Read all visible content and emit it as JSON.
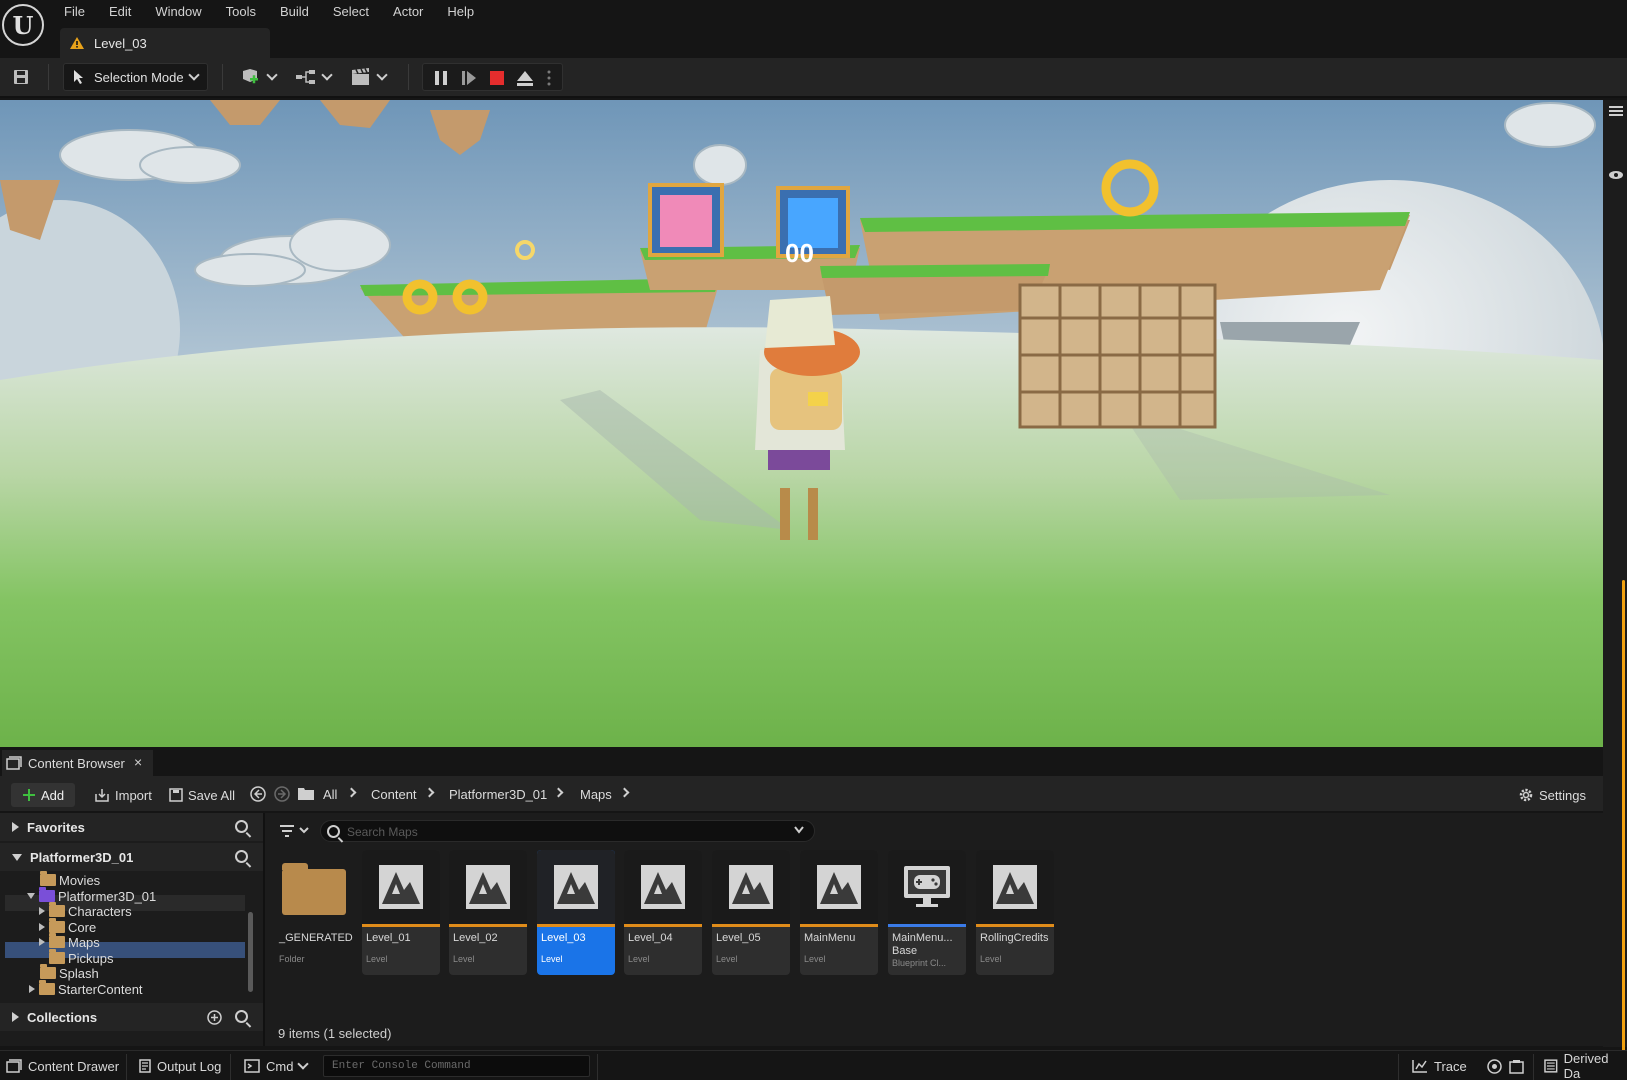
{
  "app": {
    "logo_text": "U",
    "menu": [
      "File",
      "Edit",
      "Window",
      "Tools",
      "Build",
      "Select",
      "Actor",
      "Help"
    ],
    "level_tab": "Level_03"
  },
  "toolbar": {
    "selection_mode": "Selection Mode",
    "icons": [
      "save-icon",
      "add-actor-icon",
      "blueprint-icon",
      "cinematics-icon",
      "pause-icon",
      "step-icon",
      "stop-icon",
      "eject-icon",
      "more-icon"
    ]
  },
  "viewport": {
    "scene": "game-viewport",
    "sky_color": "#8eb3cf",
    "ground_color": "#7cc26a",
    "portal_text": "00"
  },
  "content_browser": {
    "tab_label": "Content Browser",
    "add_label": "Add",
    "import_label": "Import",
    "save_all_label": "Save All",
    "settings_label": "Settings",
    "breadcrumbs": [
      "All",
      "Content",
      "Platformer3D_01",
      "Maps"
    ],
    "search_placeholder": "Search Maps",
    "favorites_label": "Favorites",
    "project_label": "Platformer3D_01",
    "collections_label": "Collections",
    "tree": [
      "Movies",
      "Platformer3D_01",
      "Characters",
      "Core",
      "Maps",
      "Pickups",
      "Splash",
      "StarterContent"
    ],
    "assets": [
      {
        "name": "_GENERATED",
        "type": "Folder"
      },
      {
        "name": "Level_01",
        "type": "Level"
      },
      {
        "name": "Level_02",
        "type": "Level"
      },
      {
        "name": "Level_03",
        "type": "Level"
      },
      {
        "name": "Level_04",
        "type": "Level"
      },
      {
        "name": "Level_05",
        "type": "Level"
      },
      {
        "name": "MainMenu",
        "type": "Level"
      },
      {
        "name": "MainMenu... Base",
        "type": "Blueprint Cl..."
      },
      {
        "name": "RollingCredits",
        "type": "Level"
      }
    ],
    "items_count": "9 items (1 selected)",
    "selected_index": 3,
    "colors": {
      "level_bar": "#e08c1a",
      "blueprint_bar": "#3a7be8",
      "selection": "#1a74e8"
    }
  },
  "statusbar": {
    "content_drawer": "Content Drawer",
    "output_log": "Output Log",
    "cmd": "Cmd",
    "console_placeholder": "Enter Console Command",
    "trace": "Trace",
    "derived_data": "Derived Da"
  }
}
